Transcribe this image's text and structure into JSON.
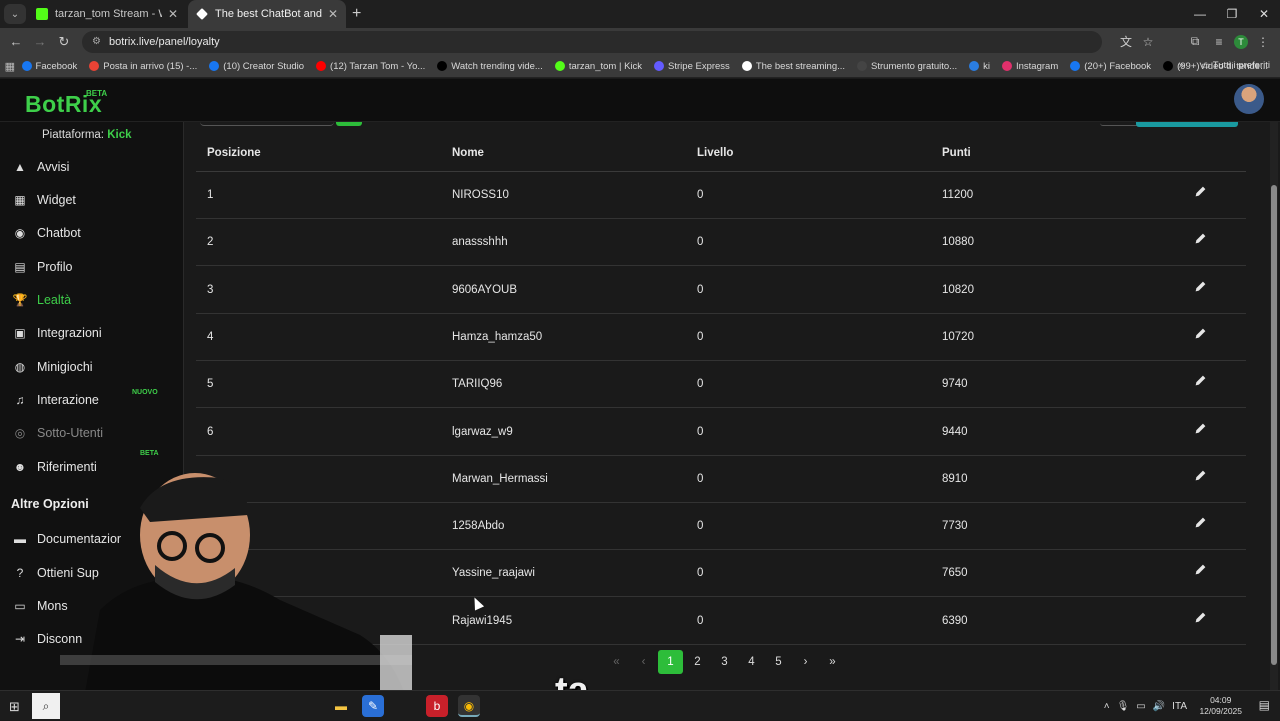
{
  "browser": {
    "tabs": [
      {
        "label": "tarzan_tom Stream - Watch Live",
        "favicon_color": "#53fc18"
      },
      {
        "label": "The best ChatBot and Widgets",
        "favicon_color": "#ffffff"
      }
    ],
    "url": "botrix.live/panel/loyalty",
    "bookmarks": [
      {
        "label": "Facebook",
        "color": "#1877f2"
      },
      {
        "label": "Posta in arrivo (15) -...",
        "color": "#ea4335"
      },
      {
        "label": "(10) Creator Studio",
        "color": "#1877f2"
      },
      {
        "label": "(12) Tarzan Tom - Yo...",
        "color": "#ff0000"
      },
      {
        "label": "Watch trending vide...",
        "color": "#000000"
      },
      {
        "label": "tarzan_tom | Kick",
        "color": "#53fc18"
      },
      {
        "label": "Stripe Express",
        "color": "#635bff"
      },
      {
        "label": "The best streaming...",
        "color": "#ffffff"
      },
      {
        "label": "Strumento gratuito...",
        "color": "#444444"
      },
      {
        "label": "ki",
        "color": "#2a7de1"
      },
      {
        "label": "Instagram",
        "color": "#e1306c"
      },
      {
        "label": "(20+) Facebook",
        "color": "#1877f2"
      },
      {
        "label": "(99+)Video di tende...",
        "color": "#000000"
      }
    ],
    "bookmarks_folder": "Tutti i preferiti",
    "profile_initial": "T"
  },
  "app": {
    "logo": "BotRix",
    "logo_badge": "BETA",
    "accent": "#3ecf4a",
    "platform_label": "Piattaforma:",
    "platform_value": "Kick"
  },
  "sidebar": {
    "items": [
      {
        "label": "Avvisi",
        "icon": "warning-icon",
        "state": "normal"
      },
      {
        "label": "Widget",
        "icon": "grid-icon",
        "state": "normal"
      },
      {
        "label": "Chatbot",
        "icon": "robot-icon",
        "state": "normal"
      },
      {
        "label": "Profilo",
        "icon": "id-card-icon",
        "state": "normal"
      },
      {
        "label": "Lealtà",
        "icon": "trophy-icon",
        "state": "active"
      },
      {
        "label": "Integrazioni",
        "icon": "plug-icon",
        "state": "normal"
      },
      {
        "label": "Minigiochi",
        "icon": "gamepad-icon",
        "state": "normal"
      },
      {
        "label": "Interazione",
        "icon": "music-icon",
        "state": "normal",
        "badge": "NUOVO"
      },
      {
        "label": "Sotto-Utenti",
        "icon": "users-icon",
        "state": "disabled"
      },
      {
        "label": "Riferimenti",
        "icon": "user-group-icon",
        "state": "normal",
        "badge": "BETA"
      }
    ],
    "section_title": "Altre Opzioni",
    "other_items": [
      {
        "label": "Documentazior",
        "icon": "doc-icon"
      },
      {
        "label": "Ottieni Sup",
        "icon": "help-icon"
      },
      {
        "label": "Mons",
        "icon": "monitor-icon"
      },
      {
        "label": "Disconn",
        "icon": "logout-icon"
      }
    ]
  },
  "table": {
    "headers": [
      "Posizione",
      "Nome",
      "Livello",
      "Punti"
    ],
    "rows": [
      {
        "pos": "1",
        "name": "NIROSS10",
        "level": "0",
        "points": "11200"
      },
      {
        "pos": "2",
        "name": "anassshhh",
        "level": "0",
        "points": "10880"
      },
      {
        "pos": "3",
        "name": "9606AYOUB",
        "level": "0",
        "points": "10820"
      },
      {
        "pos": "4",
        "name": "Hamza_hamza50",
        "level": "0",
        "points": "10720"
      },
      {
        "pos": "5",
        "name": "TARIIQ96",
        "level": "0",
        "points": "9740"
      },
      {
        "pos": "6",
        "name": "lgarwaz_w9",
        "level": "0",
        "points": "9440"
      },
      {
        "pos": "",
        "name": "Marwan_Hermassi",
        "level": "0",
        "points": "8910"
      },
      {
        "pos": "",
        "name": "1258Abdo",
        "level": "0",
        "points": "7730"
      },
      {
        "pos": "",
        "name": "Yassine_raajawi",
        "level": "0",
        "points": "7650"
      },
      {
        "pos": "",
        "name": "Rajawi1945",
        "level": "0",
        "points": "6390"
      }
    ]
  },
  "pagination": {
    "first": "«",
    "prev": "‹",
    "pages": [
      "1",
      "2",
      "3",
      "4",
      "5"
    ],
    "current": "1",
    "next": "›",
    "last": "»"
  },
  "taskbar": {
    "lang": "ITA",
    "time": "04:09",
    "date": "12/09/2025"
  },
  "overlay": {
    "caption": "ta"
  }
}
